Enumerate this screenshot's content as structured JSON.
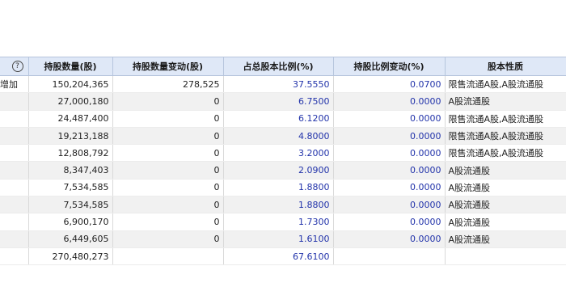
{
  "header": {
    "col0_help": "?",
    "shares": "持股数量(股)",
    "change": "持股数量变动(股)",
    "ratio": "占总股本比例(%)",
    "ratio_change": "持股比例变动(%)",
    "nature": "股本性质"
  },
  "rows": [
    {
      "note": "增加",
      "shares": "150,204,365",
      "change": "278,525",
      "ratio": "37.5550",
      "ratio_change": "0.0700",
      "nature": "限售流通A股,A股流通股"
    },
    {
      "note": "",
      "shares": "27,000,180",
      "change": "0",
      "ratio": "6.7500",
      "ratio_change": "0.0000",
      "nature": "A股流通股"
    },
    {
      "note": "",
      "shares": "24,487,400",
      "change": "0",
      "ratio": "6.1200",
      "ratio_change": "0.0000",
      "nature": "限售流通A股,A股流通股"
    },
    {
      "note": "",
      "shares": "19,213,188",
      "change": "0",
      "ratio": "4.8000",
      "ratio_change": "0.0000",
      "nature": "限售流通A股,A股流通股"
    },
    {
      "note": "",
      "shares": "12,808,792",
      "change": "0",
      "ratio": "3.2000",
      "ratio_change": "0.0000",
      "nature": "限售流通A股,A股流通股"
    },
    {
      "note": "",
      "shares": "8,347,403",
      "change": "0",
      "ratio": "2.0900",
      "ratio_change": "0.0000",
      "nature": "A股流通股"
    },
    {
      "note": "",
      "shares": "7,534,585",
      "change": "0",
      "ratio": "1.8800",
      "ratio_change": "0.0000",
      "nature": "A股流通股"
    },
    {
      "note": "",
      "shares": "7,534,585",
      "change": "0",
      "ratio": "1.8800",
      "ratio_change": "0.0000",
      "nature": "A股流通股"
    },
    {
      "note": "",
      "shares": "6,900,170",
      "change": "0",
      "ratio": "1.7300",
      "ratio_change": "0.0000",
      "nature": "A股流通股"
    },
    {
      "note": "",
      "shares": "6,449,605",
      "change": "0",
      "ratio": "1.6100",
      "ratio_change": "0.0000",
      "nature": "A股流通股"
    }
  ],
  "total": {
    "shares": "270,480,273",
    "ratio": "67.6100"
  }
}
